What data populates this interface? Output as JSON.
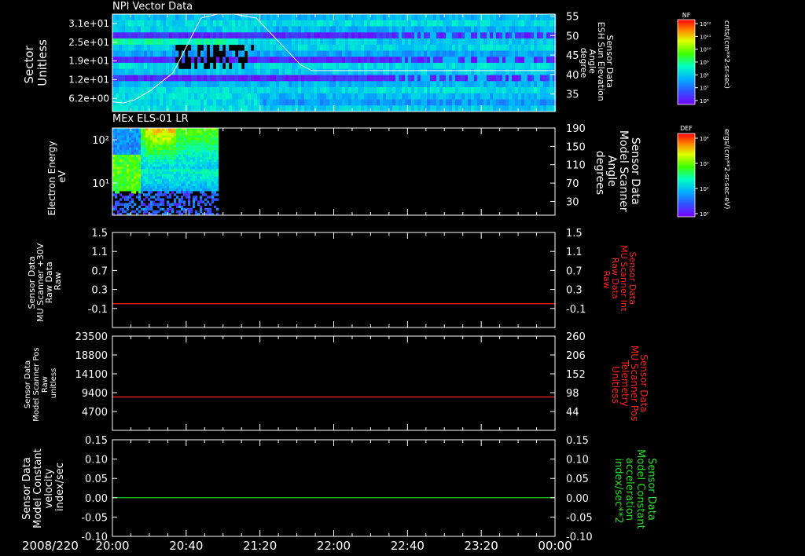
{
  "chart_data": [
    {
      "type": "heatmap",
      "title": "NPI Vector Data",
      "ylabel": [
        "Sector",
        "Unitless"
      ],
      "yticks": [
        "3.1e+01",
        "2.5e+01",
        "1.9e+01",
        "1.2e+01",
        "6.2e+00"
      ],
      "right_ylabel": [
        "Sensor Data",
        "ESH Sun Elevation",
        "Angle",
        "degree"
      ],
      "right_yticks": [
        55,
        50,
        45,
        40,
        35
      ],
      "right_ylim": [
        30,
        55
      ],
      "overlay_color": "#ffffff",
      "overlay_line": {
        "x_hours": [
          0.0,
          0.1,
          0.2,
          0.35,
          0.55,
          0.8,
          0.95,
          1.1,
          1.3,
          1.5,
          1.7,
          1.8,
          4.0
        ],
        "y": [
          32.5,
          32.2,
          33,
          35.5,
          40,
          54,
          56,
          56,
          54,
          48,
          42,
          40.5,
          40.5
        ]
      },
      "colorbar": {
        "label": "NF",
        "unit": "cnts/(cm**2-sr-sec)",
        "ticks": [
          "10¹²",
          "10¹¹",
          "10¹⁰",
          "10⁹",
          "10⁸",
          "10⁷",
          "10⁶"
        ]
      }
    },
    {
      "type": "heatmap",
      "title": "MEx ELS-01 LR",
      "ylabel": [
        "Electron Energy",
        "eV"
      ],
      "yticks": [
        "10²",
        "10¹"
      ],
      "right_ylabel": [
        "Sensor Data",
        "Model Scanner",
        "Angle",
        "degrees"
      ],
      "right_yticks": [
        190,
        150,
        110,
        70,
        30
      ],
      "right_ylim": [
        0,
        190
      ],
      "data_x_range_hours": [
        0,
        0.95
      ],
      "overlay_color": "#ffffff",
      "overlay_value": 0,
      "colorbar": {
        "label": "DEF",
        "unit": "ergs/(cm**2-sr-sec-eV)",
        "ticks": [
          "10⁴",
          "10³",
          "10²",
          "10¹"
        ]
      }
    },
    {
      "type": "line",
      "ylabel": [
        "Sensor Data",
        "MU Scanner +30V",
        "Raw Data",
        "Raw"
      ],
      "yticks": [
        "1.5",
        "1.1",
        "0.7",
        "0.3",
        "-0.1"
      ],
      "yvals": [
        1.5,
        1.1,
        0.7,
        0.3,
        -0.1
      ],
      "ylim": [
        -0.5,
        1.5
      ],
      "right_ylabel": [
        "Sensor Data",
        "MU Scanner Int",
        "Raw Data",
        "Raw"
      ],
      "right_yticks": [
        "1.5",
        "1.1",
        "0.7",
        "0.3",
        "-0.1"
      ],
      "label_color": "#ff2020",
      "series": [
        {
          "color": "#ff2020",
          "x_hours": [
            0,
            4
          ],
          "y": [
            0,
            0
          ]
        }
      ]
    },
    {
      "type": "line",
      "ylabel": [
        "Sensor Data",
        "Model Scanner Pos",
        "Raw",
        "unitless"
      ],
      "yticks": [
        "23500",
        "18800",
        "14100",
        "9400",
        "4700"
      ],
      "yvals": [
        23500,
        18800,
        14100,
        9400,
        4700
      ],
      "ylim": [
        0,
        23500
      ],
      "right_ylabel": [
        "Sensor Data",
        "MU Scanner Pos",
        "Telemetry",
        "Unitless"
      ],
      "right_yticks": [
        "260",
        "206",
        "152",
        "98",
        "44"
      ],
      "label_color": "#ff2020",
      "series": [
        {
          "color": "#ff2020",
          "x_hours": [
            0,
            4
          ],
          "y": [
            8330,
            8330
          ]
        }
      ]
    },
    {
      "type": "line",
      "ylabel": [
        "Sensor Data",
        "Model Constant",
        "velocity",
        "index/sec"
      ],
      "yticks": [
        "0.15",
        "0.10",
        "0.05",
        "0.00",
        "-0.05",
        "-0.10"
      ],
      "yvals": [
        0.15,
        0.1,
        0.05,
        0.0,
        -0.05,
        -0.1
      ],
      "ylim": [
        -0.1,
        0.15
      ],
      "right_ylabel": [
        "Sensor Data",
        "Model Constant",
        "acceleration",
        "index/sec**2"
      ],
      "right_yticks": [
        "0.15",
        "0.10",
        "0.05",
        "0.00",
        "-0.05",
        "-0.10"
      ],
      "label_color": "#20e020",
      "series": [
        {
          "color": "#20e020",
          "x_hours": [
            0,
            4
          ],
          "y": [
            0,
            0
          ]
        }
      ]
    }
  ],
  "x_axis": {
    "date_label": "2008/220",
    "ticks": [
      "20:00",
      "20:40",
      "21:20",
      "22:00",
      "22:40",
      "23:20",
      "00:00"
    ],
    "tick_hours": [
      0,
      0.6667,
      1.3333,
      2,
      2.6667,
      3.3333,
      4
    ],
    "xlim_hours": [
      0,
      4
    ]
  }
}
